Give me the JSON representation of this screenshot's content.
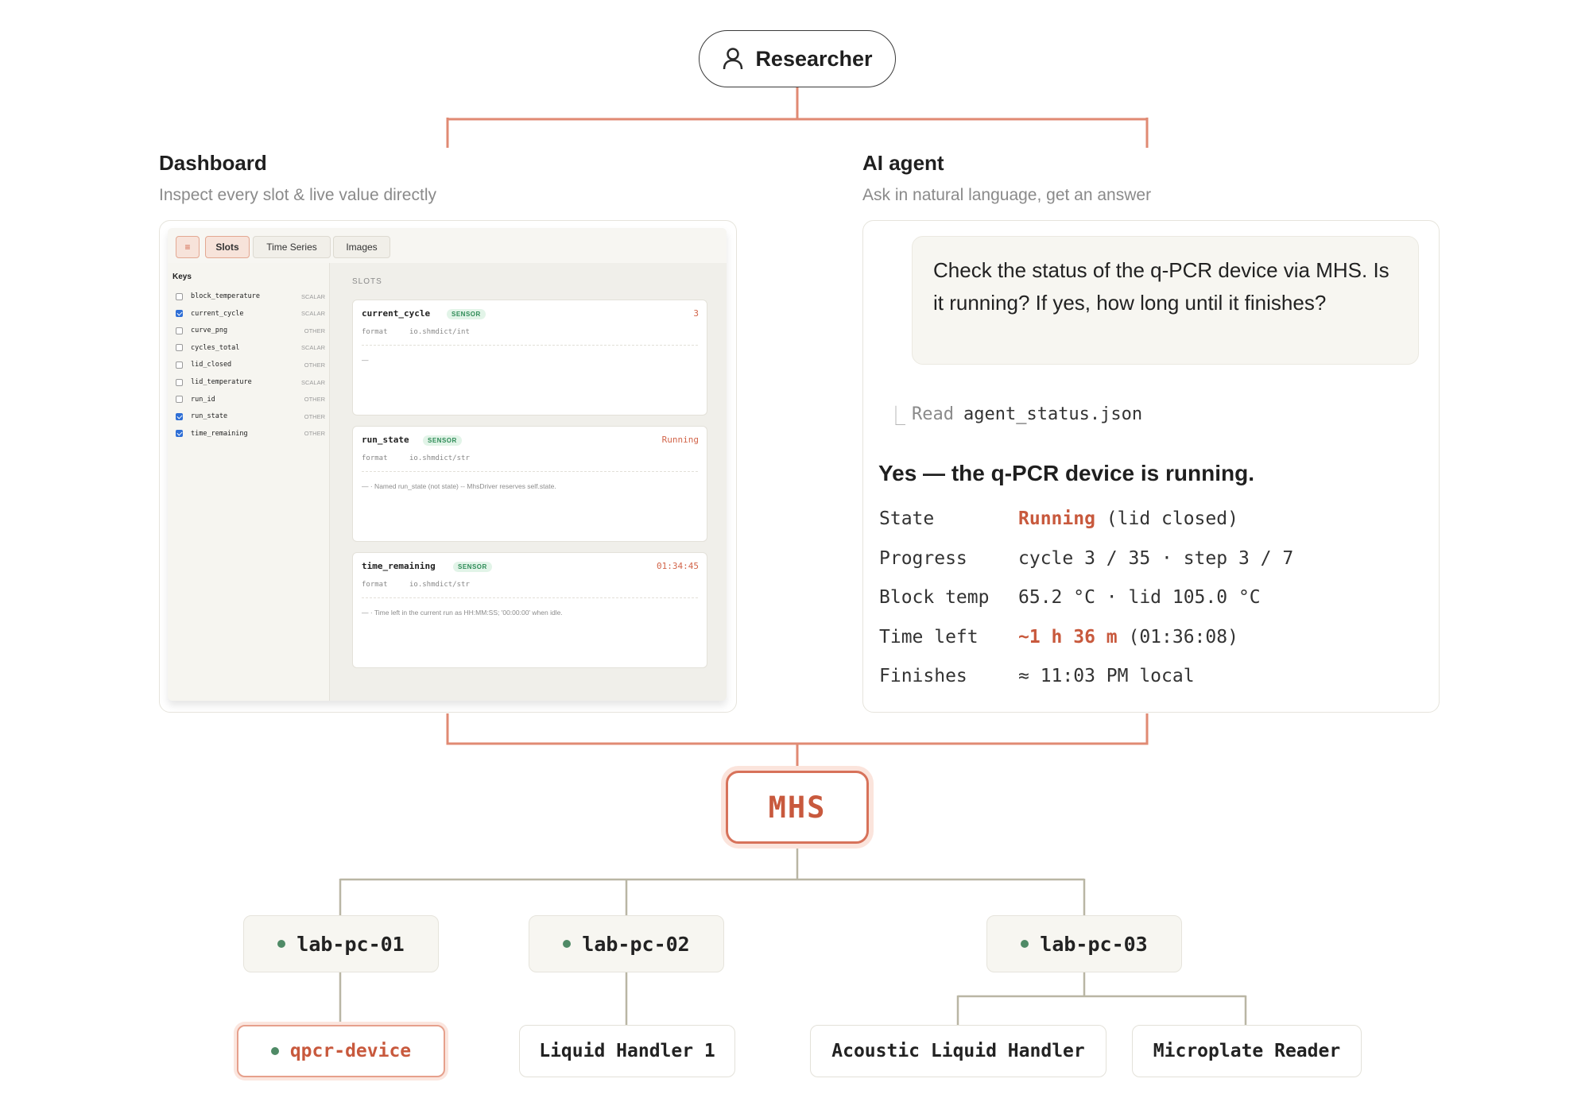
{
  "researcher": {
    "label": "Researcher",
    "icon": "user-icon"
  },
  "dashboard": {
    "title": "Dashboard",
    "subtitle": "Inspect every slot & live value directly",
    "tabs": {
      "menu": "≡",
      "slots": "Slots",
      "time_series": "Time Series",
      "images": "Images"
    },
    "keys_title": "Keys",
    "keys": [
      {
        "name": "block_temperature",
        "type": "SCALAR",
        "checked": false
      },
      {
        "name": "current_cycle",
        "type": "SCALAR",
        "checked": true
      },
      {
        "name": "curve_png",
        "type": "OTHER",
        "checked": false
      },
      {
        "name": "cycles_total",
        "type": "SCALAR",
        "checked": false
      },
      {
        "name": "lid_closed",
        "type": "OTHER",
        "checked": false
      },
      {
        "name": "lid_temperature",
        "type": "SCALAR",
        "checked": false
      },
      {
        "name": "run_id",
        "type": "OTHER",
        "checked": false
      },
      {
        "name": "run_state",
        "type": "OTHER",
        "checked": true
      },
      {
        "name": "time_remaining",
        "type": "OTHER",
        "checked": true
      }
    ],
    "slots_header": "SLOTS",
    "slots": [
      {
        "name": "current_cycle",
        "badge": "SENSOR",
        "value": "3",
        "format_label": "format",
        "format": "io.shmdict/int",
        "description": "—"
      },
      {
        "name": "run_state",
        "badge": "SENSOR",
        "value": "Running",
        "format_label": "format",
        "format": "io.shmdict/str",
        "description": "— · Named run_state (not state) -- MhsDriver reserves self.state."
      },
      {
        "name": "time_remaining",
        "badge": "SENSOR",
        "value": "01:34:45",
        "format_label": "format",
        "format": "io.shmdict/str",
        "description": "— · Time left in the current run as HH:MM:SS; '00:00:00' when idle."
      }
    ]
  },
  "agent": {
    "title": "AI agent",
    "subtitle": "Ask in natural language, get an answer",
    "prompt": "Check the status of the q-PCR device via MHS. Is it running? If yes, how long until it finishes?",
    "read_glyph": "⎿",
    "read_verb": "Read",
    "read_file": "agent_status.json",
    "answer": "Yes — the q-PCR device is running.",
    "rows": [
      {
        "label": "State",
        "highlight": "Running",
        "rest": " (lid closed)"
      },
      {
        "label": "Progress",
        "highlight": "",
        "rest": "cycle 3 / 35 · step 3 / 7"
      },
      {
        "label": "Block temp",
        "highlight": "",
        "rest": "65.2 °C · lid 105.0 °C"
      },
      {
        "label": "Time left",
        "highlight": "~1 h 36 m",
        "rest": " (01:36:08)"
      },
      {
        "label": "Finishes",
        "highlight": "",
        "rest": "≈ 11:03 PM local"
      }
    ]
  },
  "mhs": {
    "label": "MHS"
  },
  "pcs": [
    {
      "label": "lab-pc-01"
    },
    {
      "label": "lab-pc-02"
    },
    {
      "label": "lab-pc-03"
    }
  ],
  "devices": [
    {
      "label": "qpcr-device",
      "active": true
    },
    {
      "label": "Liquid Handler 1",
      "active": false
    },
    {
      "label": "Acoustic Liquid Handler",
      "active": false
    },
    {
      "label": "Microplate Reader",
      "active": false
    }
  ],
  "colors": {
    "accent": "#d7725a",
    "accent_text": "#c8593d",
    "tree_line": "#b9b6a4",
    "status_dot": "#4f8a66"
  }
}
